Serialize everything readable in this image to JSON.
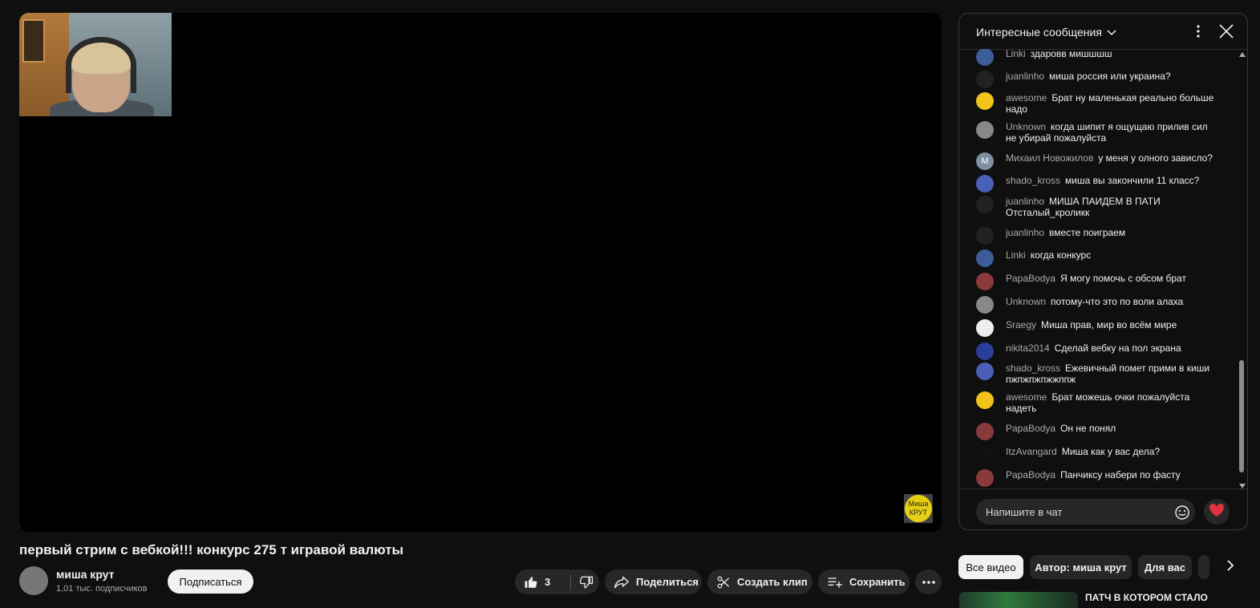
{
  "video": {
    "title": "первый стрим с вебкой!!! конкурс 275 т игравой валюты",
    "watermark_line1": "Миша",
    "watermark_line2": "КРУТ"
  },
  "channel": {
    "name": "миша крут",
    "subscribers": "1,01 тыс. подписчиков",
    "subscribe_label": "Подписаться"
  },
  "actions": {
    "like_count": "3",
    "share_label": "Поделиться",
    "clip_label": "Создать клип",
    "save_label": "Сохранить",
    "icons": [
      "thumb-up-icon",
      "thumb-down-icon",
      "share-arrow-icon",
      "scissors-icon",
      "playlist-add-icon",
      "more-horizontal-icon"
    ]
  },
  "chat": {
    "title": "Интересные сообщения",
    "input_placeholder": "Напишите в чат",
    "messages": [
      {
        "author": "Linki",
        "text": "здаровв мишшшш",
        "avatar": "#3d5c9a"
      },
      {
        "author": "juanlinho",
        "text": "миша россия или украина?",
        "avatar": "#222222"
      },
      {
        "author": "awesome",
        "text": "Брат ну маленькая реально больше надо",
        "avatar": "#f2c318"
      },
      {
        "author": "Unknown",
        "text": "когда шипит я ощущаю прилив сил не убирай пожалуйста",
        "avatar": "#888888"
      },
      {
        "author": "Михаил Новожилов",
        "text": "у меня у олного зависло?",
        "avatar": "#7d8fa0",
        "initial": "М"
      },
      {
        "author": "shado_kross",
        "text": "миша вы закончили 11 класс?",
        "avatar": "#4a5fb8"
      },
      {
        "author": "juanlinho",
        "text": "МИША ПАИДЕМ В ПАТИ Отсталый_кроликк",
        "avatar": "#222222"
      },
      {
        "author": "juanlinho",
        "text": "вместе поиграем",
        "avatar": "#222222"
      },
      {
        "author": "Linki",
        "text": "когда конкурс",
        "avatar": "#3d5c9a"
      },
      {
        "author": "PapaBodya",
        "text": "Я могу помочь с обсом брат",
        "avatar": "#8a3a3a"
      },
      {
        "author": "Unknown",
        "text": "потому-что это по воли алаха",
        "avatar": "#888888"
      },
      {
        "author": "Sraegy",
        "text": "Миша прав, мир во всём мире",
        "avatar": "#eeeeee"
      },
      {
        "author": "nikita2014",
        "text": "Сделай вебку на пол экрана",
        "avatar": "#2a3f9a"
      },
      {
        "author": "shado_kross",
        "text": "Ежевичный помет прими в киши пжпжпжпжжппж",
        "avatar": "#4a5fb8"
      },
      {
        "author": "awesome",
        "text": "Брат можешь очки пожалуйста надеть",
        "avatar": "#f2c318"
      },
      {
        "author": "PapaBodya",
        "text": "Он не понял",
        "avatar": "#8a3a3a"
      },
      {
        "author": "ItzAvangard",
        "text": "Миша как у вас дела?",
        "avatar": "#111111"
      },
      {
        "author": "PapaBodya",
        "text": "Панчиксу набери по фасту",
        "avatar": "#8a3a3a"
      }
    ]
  },
  "recommendations": {
    "chips": [
      "Все видео",
      "Автор: миша крут",
      "Для вас"
    ],
    "first_title": "ПАТЧ В КОТОРОМ СТАЛО"
  },
  "colors": {
    "background": "#0f0f0f",
    "surface": "#272727",
    "text": "#f1f1f1",
    "muted": "#aaaaaa"
  }
}
